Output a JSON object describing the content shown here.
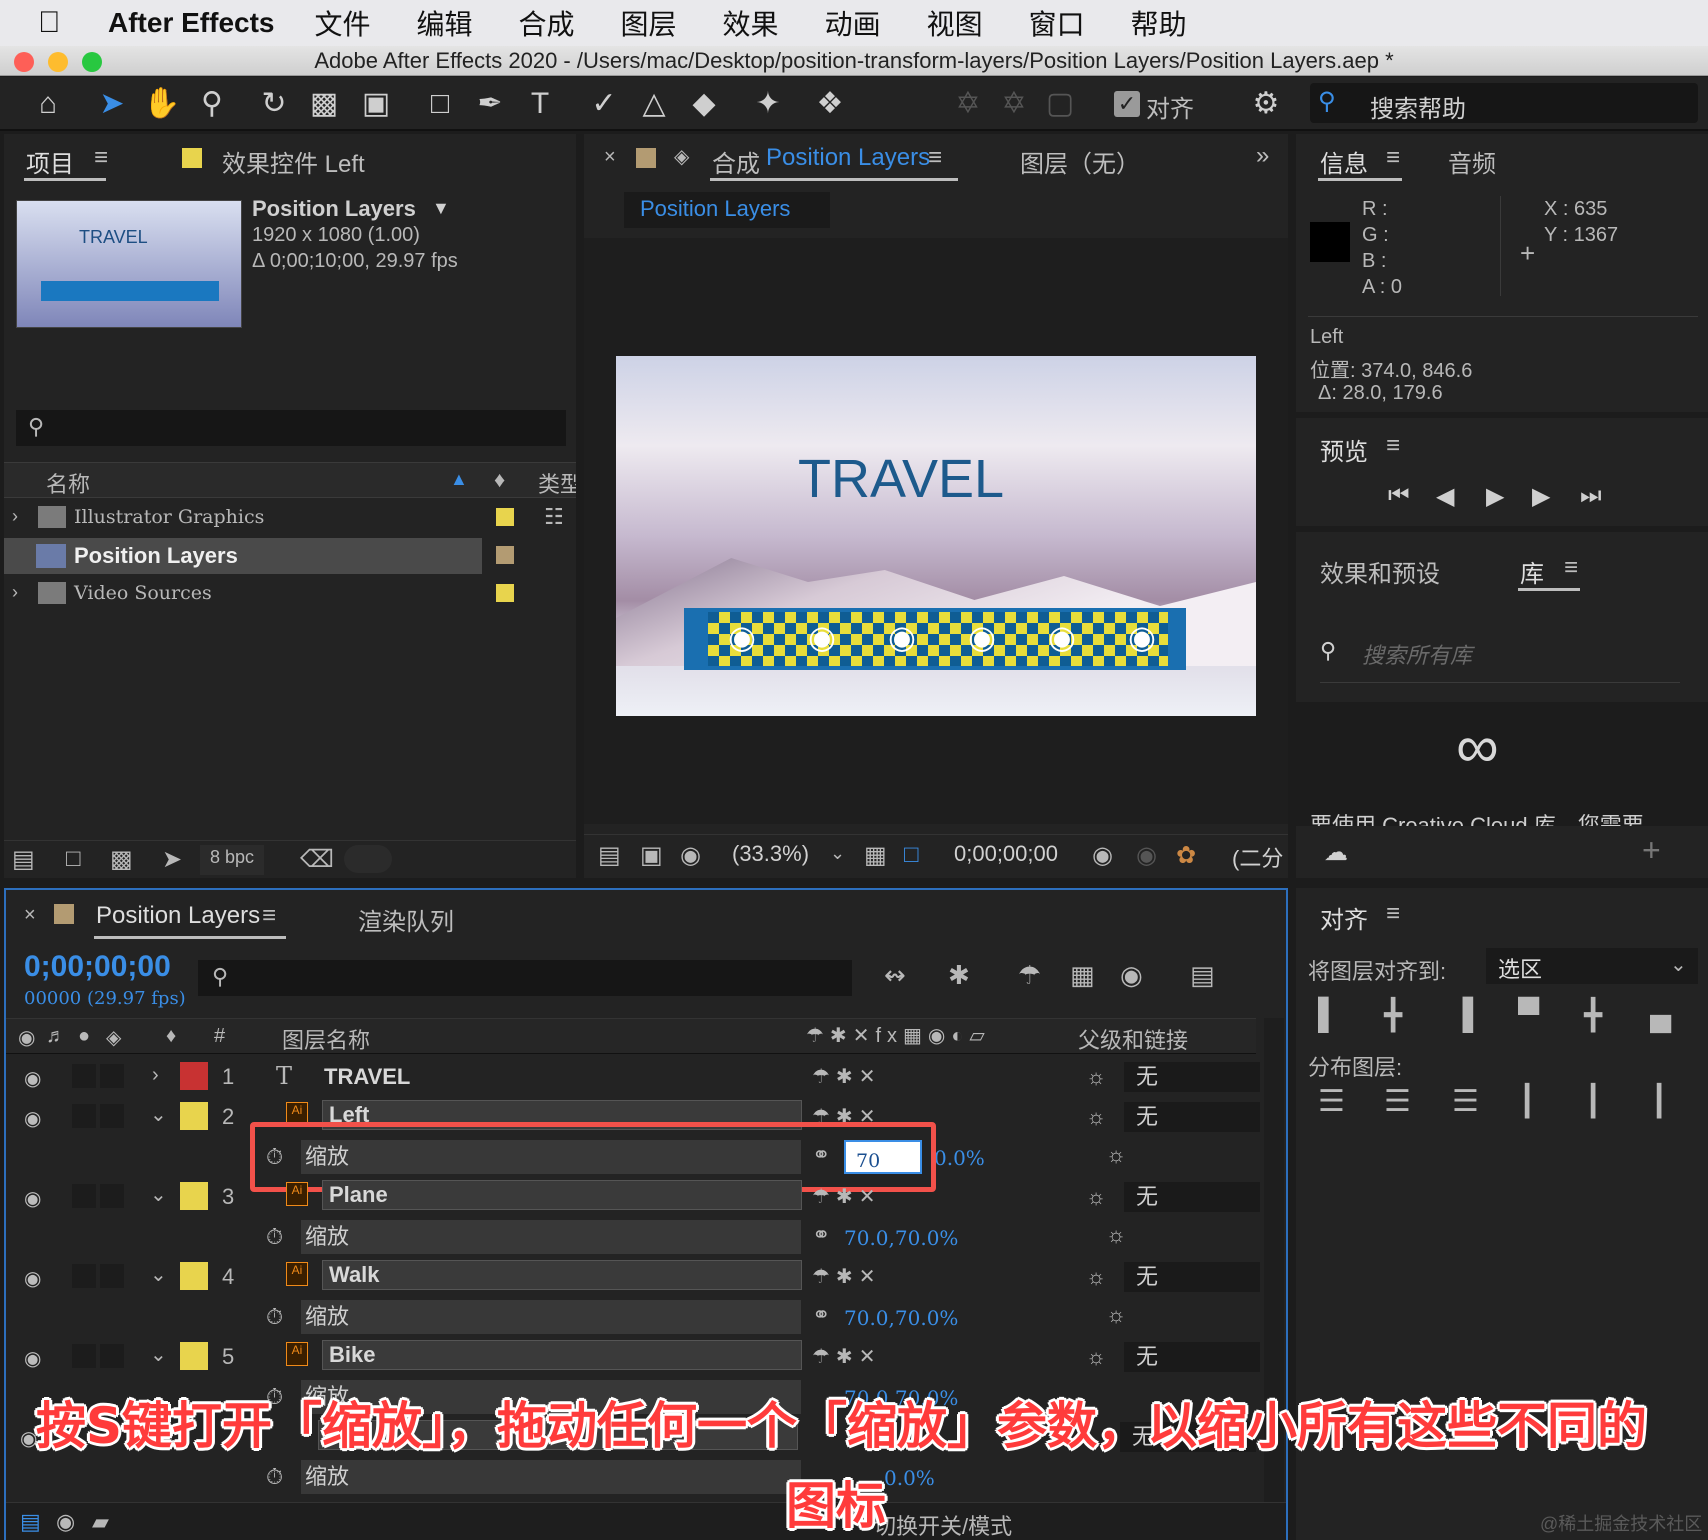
{
  "menubar": {
    "app_name": "After Effects",
    "items": [
      "文件",
      "编辑",
      "合成",
      "图层",
      "效果",
      "动画",
      "视图",
      "窗口",
      "帮助"
    ]
  },
  "window_title": "Adobe After Effects 2020 - /Users/mac/Desktop/position-transform-layers/Position Layers/Position Layers.aep *",
  "toolbar": {
    "align_label": "对齐",
    "search_help": "搜索帮助"
  },
  "project_panel": {
    "tab_project": "项目",
    "tab_effects": "效果控件 Left",
    "comp_name": "Position Layers",
    "comp_size": "1920 x 1080 (1.00)",
    "comp_duration": "Δ 0;00;10;00, 29.97 fps",
    "thumb_text": "TRAVEL",
    "col_name": "名称",
    "col_type": "类型",
    "items": [
      {
        "label": "Illustrator Graphics",
        "color": "#e8d44d"
      },
      {
        "label": "Position Layers",
        "color": "#b39b72"
      },
      {
        "label": "Video Sources",
        "color": "#e8d44d"
      }
    ],
    "bpc": "8 bpc"
  },
  "comp_panel": {
    "tab_prefix": "合成",
    "tab_name": "Position Layers",
    "tab_layer": "图层（无）",
    "sub_tab": "Position Layers",
    "canvas_title": "TRAVEL",
    "zoom": "(33.3%)",
    "timecode": "0;00;00;00",
    "resolution": "(二分"
  },
  "info_panel": {
    "tab_info": "信息",
    "tab_audio": "音频",
    "r_label": "R :",
    "g_label": "G :",
    "b_label": "B :",
    "a_label": "A :  0",
    "x_label": "X : 635",
    "y_label": "Y : 1367",
    "layer_name": "Left",
    "position": "位置: 374.0, 846.6",
    "delta": "Δ: 28.0, 179.6"
  },
  "preview_panel": {
    "title": "预览"
  },
  "effects_panel": {
    "tab_effects": "效果和预设",
    "tab_library": "库",
    "search_placeholder": "搜索所有库",
    "cut_text": "要使用 Creative Cloud 库，您需要"
  },
  "timeline": {
    "tab_name": "Position Layers",
    "tab_render": "渲染队列",
    "timecode": "0;00;00;00",
    "fps": "00000 (29.97 fps)",
    "col_num": "#",
    "col_layer_name": "图层名称",
    "col_parent": "父级和链接",
    "toggle_label": "切换开关/模式",
    "layers": [
      {
        "num": "1",
        "name": "TRAVEL",
        "color": "#c83232",
        "parent": "无"
      },
      {
        "num": "2",
        "name": "Left",
        "color": "#e8d44d",
        "parent": "无"
      },
      {
        "num": "3",
        "name": "Plane",
        "color": "#e8d44d",
        "parent": "无"
      },
      {
        "num": "4",
        "name": "Walk",
        "color": "#e8d44d",
        "parent": "无"
      },
      {
        "num": "5",
        "name": "Bike",
        "color": "#e8d44d",
        "parent": "无"
      }
    ],
    "scale_label": "缩放",
    "scale_edit_value": "70",
    "scale_edit_suffix": "0.0%",
    "scale_values": [
      "70.0,70.0%",
      "70.0,70.0%",
      "70.0,70.0%"
    ],
    "last_scale_suffix": "0.0%",
    "partial_parent": "无"
  },
  "align_panel": {
    "title": "对齐",
    "align_to_label": "将图层对齐到:",
    "align_to_value": "选区",
    "distribute_label": "分布图层:"
  },
  "caption": {
    "line1": "按S键打开「缩放」，拖动任何一个「缩放」参数，以缩小所有这些不同的",
    "line2": "图标"
  },
  "watermark": "@稀土掘金技术社区"
}
